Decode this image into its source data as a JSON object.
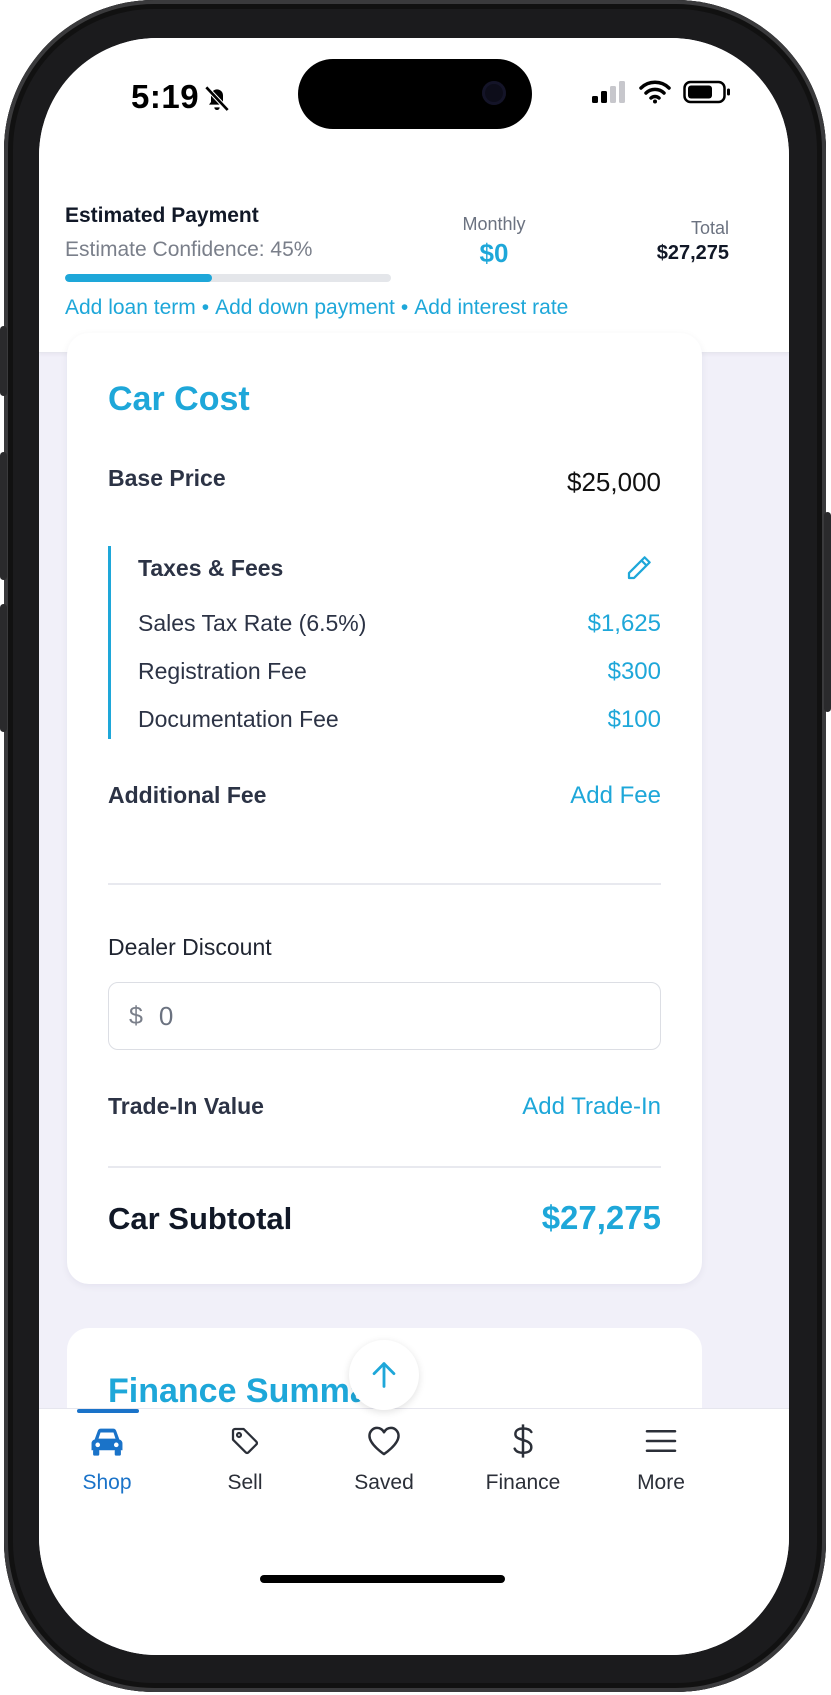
{
  "status_bar": {
    "time": "5:19"
  },
  "header": {
    "title": "Estimated Payment",
    "confidence_text": "Estimate Confidence: 45%",
    "confidence_percent": 45,
    "monthly_label": "Monthly",
    "monthly_value": "$0",
    "total_label": "Total",
    "total_value": "$27,275",
    "links": [
      "Add loan term",
      "Add down payment",
      "Add interest rate"
    ],
    "link_separator": "•"
  },
  "car_cost": {
    "title": "Car Cost",
    "base_price_label": "Base Price",
    "base_price_value": "$25,000",
    "taxes_fees_label": "Taxes & Fees",
    "sales_tax_label": "Sales Tax Rate (6.5%)",
    "sales_tax_value": "$1,625",
    "registration_label": "Registration Fee",
    "registration_value": "$300",
    "documentation_label": "Documentation Fee",
    "documentation_value": "$100",
    "additional_fee_label": "Additional Fee",
    "additional_fee_action": "Add Fee",
    "dealer_discount_label": "Dealer Discount",
    "dealer_discount_currency": "$",
    "dealer_discount_value": "0",
    "trade_in_label": "Trade-In Value",
    "trade_in_action": "Add Trade-In",
    "subtotal_label": "Car Subtotal",
    "subtotal_value": "$27,275"
  },
  "finance_summary": {
    "title": "Finance Summary"
  },
  "tabbar": {
    "items": [
      {
        "label": "Shop",
        "icon": "car-icon",
        "active": true
      },
      {
        "label": "Sell",
        "icon": "tag-icon",
        "active": false
      },
      {
        "label": "Saved",
        "icon": "heart-icon",
        "active": false
      },
      {
        "label": "Finance",
        "icon": "dollar-icon",
        "active": false
      },
      {
        "label": "More",
        "icon": "menu-icon",
        "active": false
      }
    ]
  },
  "colors": {
    "accent": "#1ea7d9",
    "nav_active": "#1a73c9",
    "page_bg": "#f1f0f9"
  }
}
